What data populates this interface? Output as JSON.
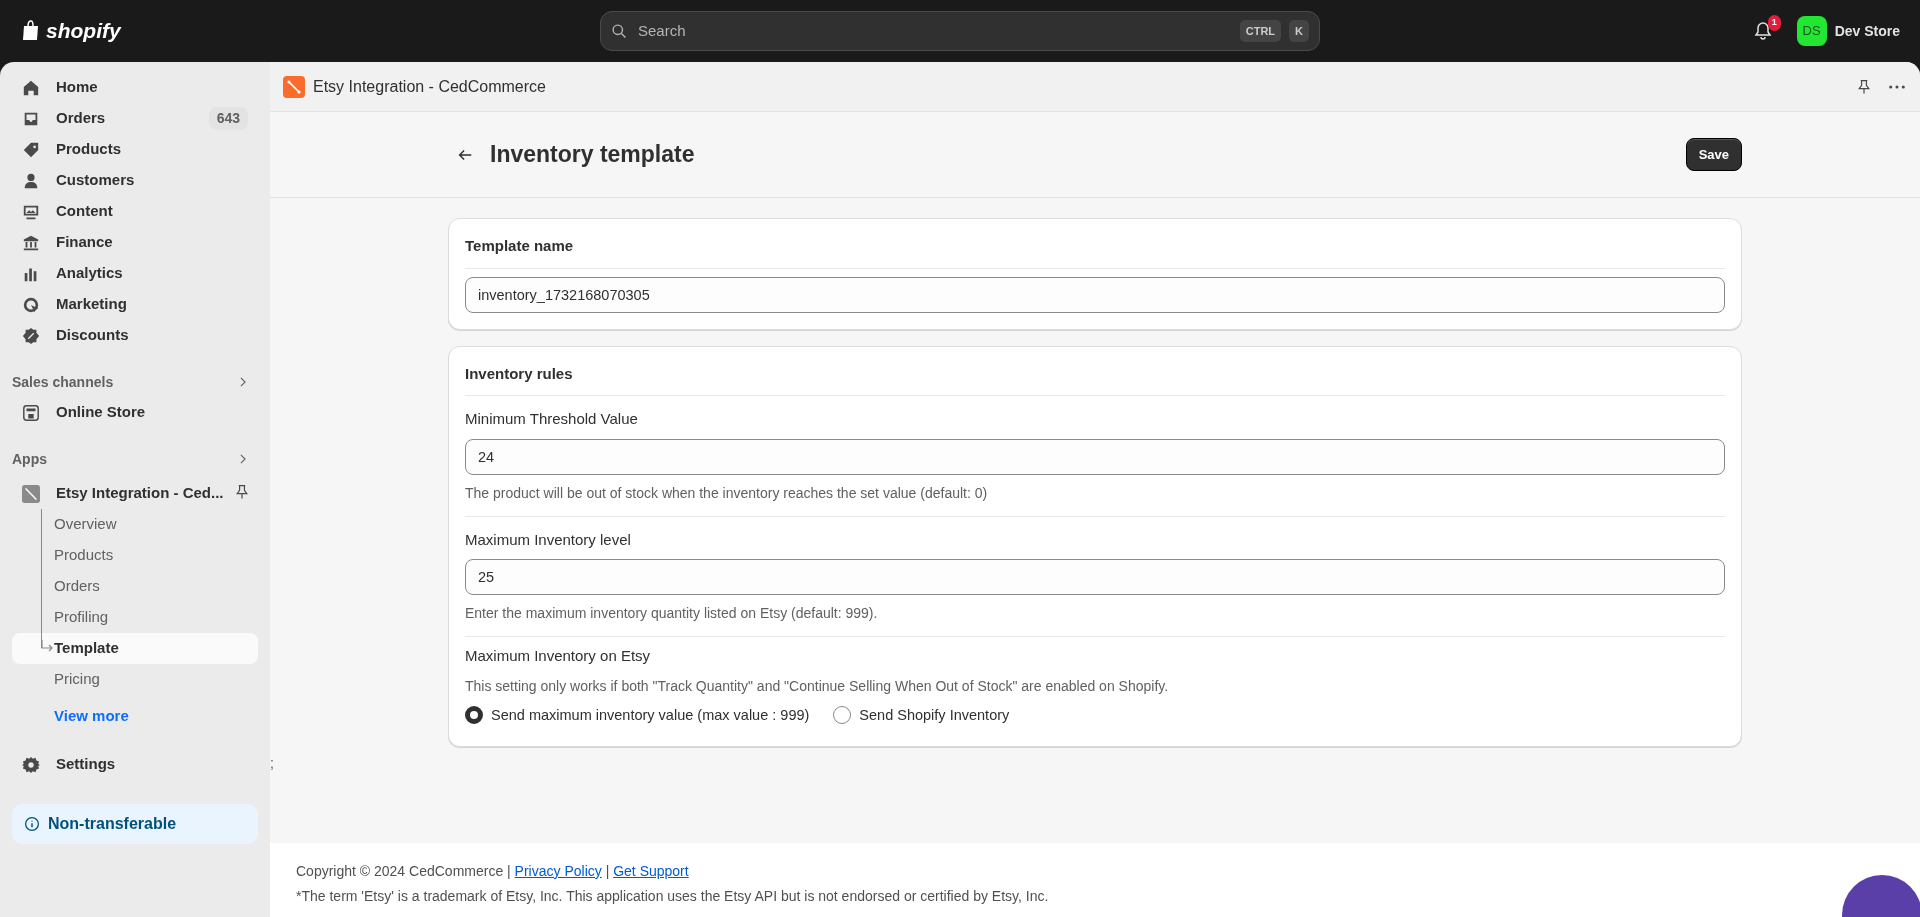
{
  "topbar": {
    "logo": "shopify",
    "search": {
      "placeholder": "Search"
    },
    "shortcut_keys": [
      "CTRL",
      "K"
    ],
    "notification_count": "1",
    "avatar_initials": "DS",
    "store_name": "Dev Store"
  },
  "sidebar": {
    "items": [
      {
        "label": "Home",
        "selected": false
      },
      {
        "label": "Orders",
        "badge": "643",
        "selected": false
      },
      {
        "label": "Products",
        "selected": false
      },
      {
        "label": "Customers",
        "selected": false
      },
      {
        "label": "Content",
        "selected": false
      },
      {
        "label": "Finance",
        "selected": false
      },
      {
        "label": "Analytics",
        "selected": false
      },
      {
        "label": "Marketing",
        "selected": false
      },
      {
        "label": "Discounts",
        "selected": false
      }
    ],
    "sales_channels": {
      "heading": "Sales channels",
      "items": [
        {
          "label": "Online Store",
          "selected": false
        }
      ]
    },
    "apps": {
      "heading": "Apps",
      "app": {
        "label": "Etsy Integration - Ced...",
        "children": [
          {
            "label": "Overview",
            "selected": false
          },
          {
            "label": "Products",
            "selected": false
          },
          {
            "label": "Orders",
            "selected": false
          },
          {
            "label": "Profiling",
            "selected": false
          },
          {
            "label": "Template",
            "selected": true
          },
          {
            "label": "Pricing",
            "selected": false
          }
        ]
      },
      "view_more": "View more"
    },
    "settings": "Settings",
    "notice": "Non-transferable"
  },
  "app_bar": {
    "title": "Etsy Integration - CedCommerce"
  },
  "page": {
    "title": "Inventory template",
    "save_button": "Save"
  },
  "template_card": {
    "title": "Template name",
    "value": "inventory_1732168070305"
  },
  "rules_card": {
    "title": "Inventory rules",
    "fields": [
      {
        "label": "Minimum Threshold Value",
        "value": "24",
        "help": "The product will be out of stock when the inventory reaches the set value (default: 0)"
      },
      {
        "label": "Maximum Inventory level",
        "value": "25",
        "help": "Enter the maximum inventory quantity listed on Etsy (default: 999)."
      }
    ],
    "etsy_option": {
      "label": "Maximum Inventory on Etsy",
      "description": "This setting only works if both \"Track Quantity\" and \"Continue Selling When Out of Stock\" are enabled on Shopify.",
      "options": [
        {
          "label": "Send maximum inventory value (max value : 999)",
          "selected": true
        },
        {
          "label": "Send Shopify Inventory",
          "selected": false
        }
      ]
    }
  },
  "stray_mark": ";",
  "footer": {
    "copyright": "Copyright © 2024 CedCommerce |",
    "links": [
      {
        "label": "Privacy Policy"
      },
      {
        "label": "Get Support"
      }
    ],
    "separator": "|",
    "disclaimer": "*The term 'Etsy' is a trademark of Etsy, Inc. This application uses the Etsy API but is not endorsed or certified by Etsy, Inc."
  }
}
